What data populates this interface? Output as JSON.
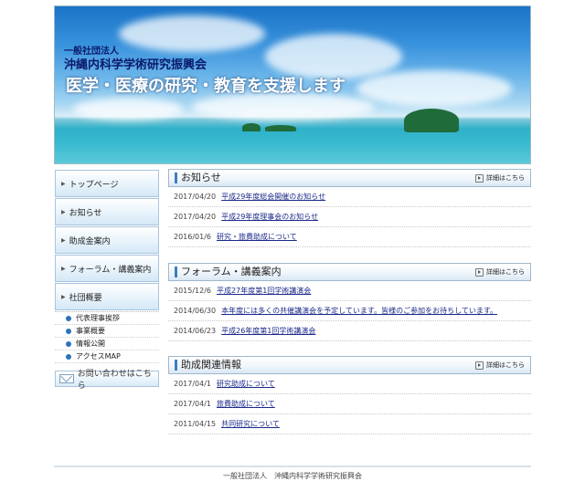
{
  "banner": {
    "org_line1": "一般社団法人",
    "org_line2": "沖縄内科学学術研究振興会",
    "tagline": "医学・医療の研究・教育を支援します"
  },
  "sidebar": {
    "items": [
      {
        "label": "トップページ"
      },
      {
        "label": "お知らせ"
      },
      {
        "label": "助成金案内"
      },
      {
        "label": "フォーラム・講義案内"
      },
      {
        "label": "社団概要"
      }
    ],
    "sub_items": [
      {
        "label": "代表理事挨拶"
      },
      {
        "label": "事業概要"
      },
      {
        "label": "情報公開"
      },
      {
        "label": "アクセスMAP"
      }
    ],
    "contact_label": "お問い合わせはこちら"
  },
  "sections": [
    {
      "title": "お知らせ",
      "more": "詳細はこちら",
      "rows": [
        {
          "date": "2017/04/20",
          "title": "平成29年度総会開催のお知らせ"
        },
        {
          "date": "2017/04/20",
          "title": "平成29年度理事会のお知らせ"
        },
        {
          "date": "2016/01/6",
          "title": "研究・旅費助成について"
        }
      ]
    },
    {
      "title": "フォーラム・講義案内",
      "more": "詳細はこちら",
      "rows": [
        {
          "date": "2015/12/6",
          "title": "平成27年度第1回学術講演会"
        },
        {
          "date": "2014/06/30",
          "title": "本年度には多くの共催講演会を予定しています。皆様のご参加をお待ちしています。"
        },
        {
          "date": "2014/06/23",
          "title": "平成26年度第1回学術講演会"
        }
      ]
    },
    {
      "title": "助成関連情報",
      "more": "詳細はこちら",
      "rows": [
        {
          "date": "2017/04/1",
          "title": "研究助成について"
        },
        {
          "date": "2017/04/1",
          "title": "旅費助成について"
        },
        {
          "date": "2011/04/15",
          "title": "共同研究について"
        }
      ]
    }
  ],
  "footer": {
    "text": "一般社団法人　沖縄内科学学術研究振興会"
  }
}
